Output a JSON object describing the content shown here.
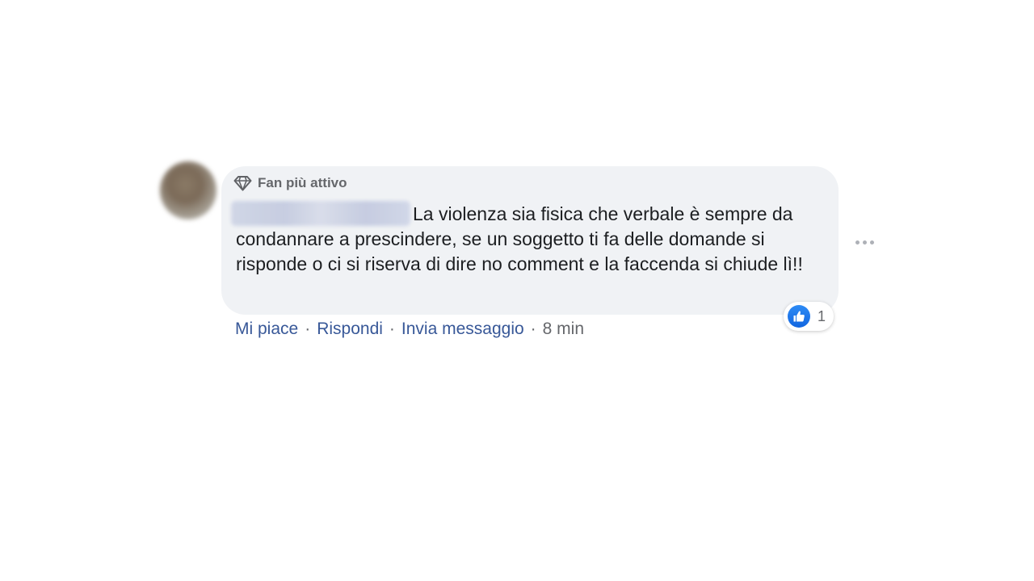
{
  "comment": {
    "badge_label": "Fan più attivo",
    "text": "La violenza sia fisica che verbale è sempre da condannare a prescindere, se un soggetto ti fa delle domande si risponde o ci si riserva di dire no comment e la faccenda si chiude lì!!",
    "reaction_count": "1",
    "icons": {
      "badge": "diamond-icon",
      "reaction": "like-icon",
      "menu": "more-options-icon"
    },
    "accent_color": "#1877f2"
  },
  "actions": {
    "like_label": "Mi piace",
    "reply_label": "Rispondi",
    "message_label": "Invia messaggio",
    "separator": "·",
    "timestamp": "8 min"
  }
}
